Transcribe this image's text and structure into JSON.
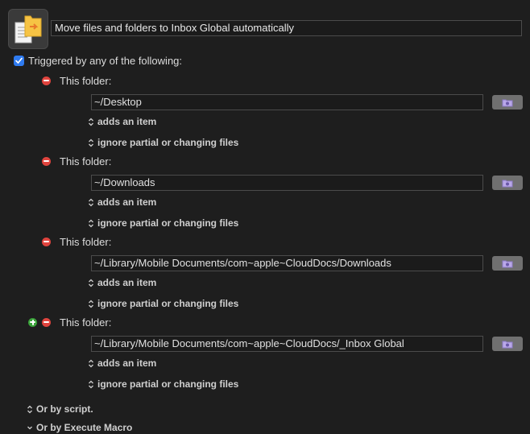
{
  "macro": {
    "icon": "document-folder-move-icon",
    "title": "Move files and folders to Inbox Global automatically"
  },
  "trigger": {
    "checked": true,
    "label": "Triggered by any of the following:"
  },
  "folders": [
    {
      "label": "This folder:",
      "path": "~/Desktop",
      "event": "adds an item",
      "option": "ignore partial or changing files"
    },
    {
      "label": "This folder:",
      "path": "~/Downloads",
      "event": "adds an item",
      "option": "ignore partial or changing files"
    },
    {
      "label": "This folder:",
      "path": "~/Library/Mobile Documents/com~apple~CloudDocs/Downloads",
      "event": "adds an item",
      "option": "ignore partial or changing files"
    },
    {
      "label": "This folder:",
      "path": "~/Library/Mobile Documents/com~apple~CloudDocs/_Inbox Global",
      "event": "adds an item",
      "option": "ignore partial or changing files"
    }
  ],
  "footer": {
    "script_option": "Or by script.",
    "execute_option": "Or by Execute Macro"
  },
  "colors": {
    "background": "#1e1e1e",
    "remove": "#e0443e",
    "add": "#3aa33a",
    "checkbox": "#2f7bf0",
    "browse": "#707070"
  }
}
